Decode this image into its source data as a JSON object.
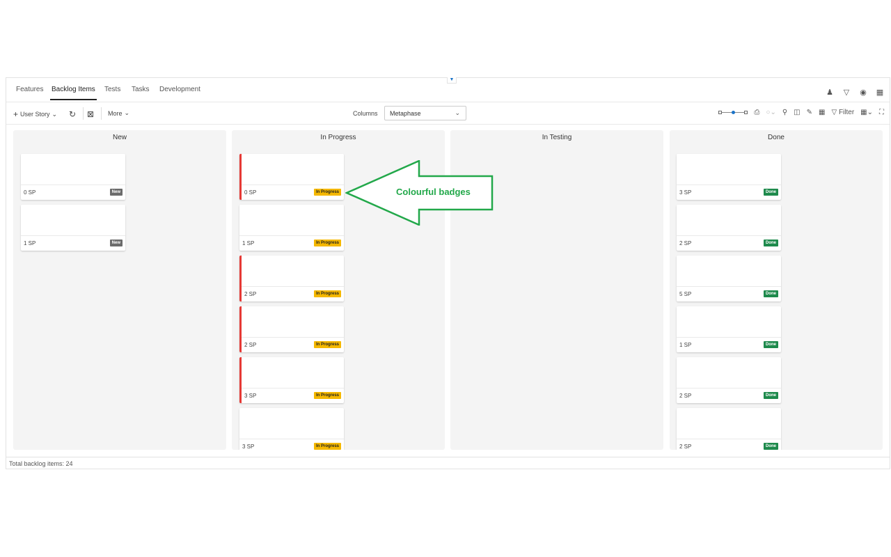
{
  "tabs": [
    {
      "label": "Features",
      "active": false
    },
    {
      "label": "Backlog Items",
      "active": true
    },
    {
      "label": "Tests",
      "active": false
    },
    {
      "label": "Tasks",
      "active": false
    },
    {
      "label": "Development",
      "active": false
    }
  ],
  "toolbar": {
    "add_label": "User Story",
    "more_label": "More",
    "columns_label": "Columns",
    "columns_value": "Metaphase",
    "filter_label": "Filter"
  },
  "columns": [
    {
      "title": "New"
    },
    {
      "title": "In Progress"
    },
    {
      "title": "In Testing"
    },
    {
      "title": "Done"
    }
  ],
  "cards": {
    "new": [
      {
        "sp": "0 SP",
        "badge": "New",
        "flag": false
      },
      {
        "sp": "1 SP",
        "badge": "New",
        "flag": false
      }
    ],
    "in_progress": [
      {
        "sp": "0 SP",
        "badge": "In Progress",
        "flag": true
      },
      {
        "sp": "1 SP",
        "badge": "In Progress",
        "flag": false
      },
      {
        "sp": "2 SP",
        "badge": "In Progress",
        "flag": true
      },
      {
        "sp": "2 SP",
        "badge": "In Progress",
        "flag": true
      },
      {
        "sp": "3 SP",
        "badge": "In Progress",
        "flag": true
      },
      {
        "sp": "3 SP",
        "badge": "In Progress",
        "flag": false
      }
    ],
    "done": [
      {
        "sp": "3 SP",
        "badge": "Done",
        "flag": false
      },
      {
        "sp": "2 SP",
        "badge": "Done",
        "flag": false
      },
      {
        "sp": "5 SP",
        "badge": "Done",
        "flag": false
      },
      {
        "sp": "1 SP",
        "badge": "Done",
        "flag": false
      },
      {
        "sp": "2 SP",
        "badge": "Done",
        "flag": false
      },
      {
        "sp": "2 SP",
        "badge": "Done",
        "flag": false
      }
    ]
  },
  "badge_colors": {
    "New": {
      "bg": "#6b6b6b",
      "fg": "#ffffff"
    },
    "In Progress": {
      "bg": "#f5b800",
      "fg": "#222222"
    },
    "Done": {
      "bg": "#1e8a4c",
      "fg": "#ffffff"
    }
  },
  "flag_color": "#e53935",
  "footer": {
    "total_label": "Total backlog items: 24"
  },
  "annotation": {
    "text": "Colourful badges",
    "color": "#22a84a"
  }
}
